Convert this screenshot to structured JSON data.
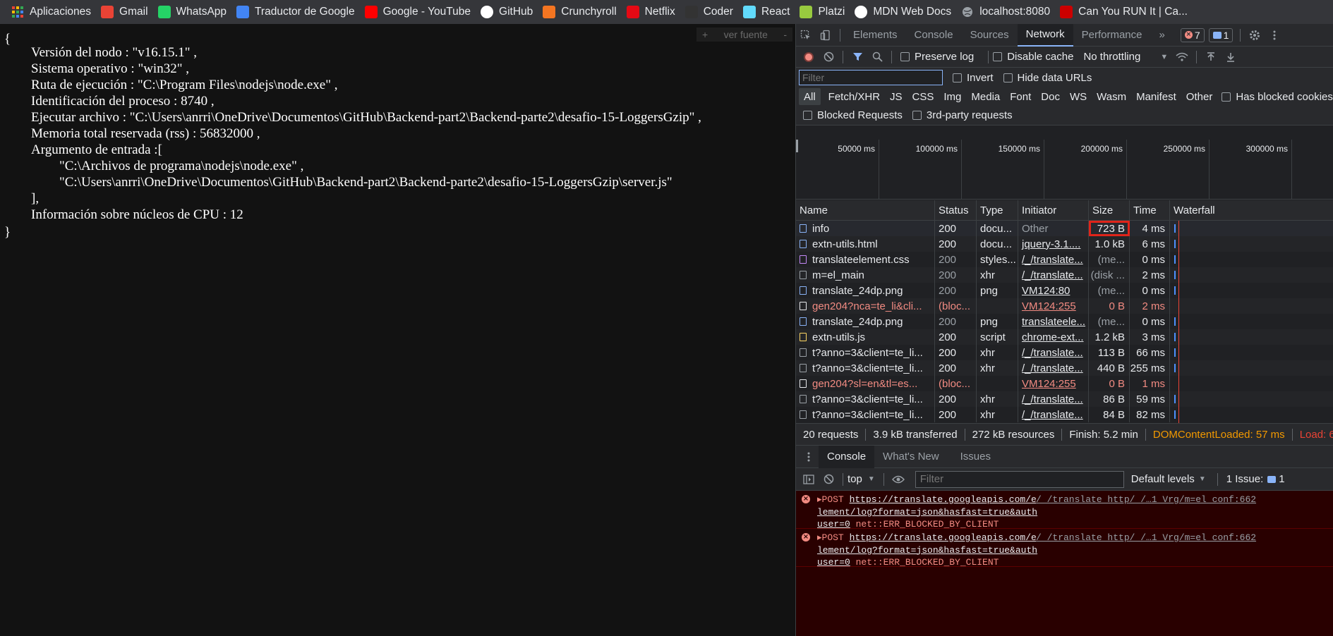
{
  "bookmarks": [
    {
      "label": "Aplicaciones",
      "icon": "apps-grid-icon",
      "color": "#4285f4"
    },
    {
      "label": "Gmail",
      "icon": "gmail-icon",
      "color": "#ea4335"
    },
    {
      "label": "WhatsApp",
      "icon": "whatsapp-icon",
      "color": "#25d366"
    },
    {
      "label": "Traductor de Google",
      "icon": "google-translate-icon",
      "color": "#4285f4"
    },
    {
      "label": "Google - YouTube",
      "icon": "youtube-icon",
      "color": "#ff0000"
    },
    {
      "label": "GitHub",
      "icon": "github-icon",
      "color": "#ffffff"
    },
    {
      "label": "Crunchyroll",
      "icon": "crunchyroll-icon",
      "color": "#f47521"
    },
    {
      "label": "Netflix",
      "icon": "netflix-icon",
      "color": "#e50914"
    },
    {
      "label": "Coder",
      "icon": "coder-icon",
      "color": "#333333"
    },
    {
      "label": "React",
      "icon": "react-icon",
      "color": "#61dafb"
    },
    {
      "label": "Platzi",
      "icon": "platzi-icon",
      "color": "#98ca3f"
    },
    {
      "label": "MDN Web Docs",
      "icon": "mdn-icon",
      "color": "#ffffff"
    },
    {
      "label": "localhost:8080",
      "icon": "globe-icon",
      "color": "#9aa0a6"
    },
    {
      "label": "Can You RUN It | Ca...",
      "icon": "canyourunit-icon",
      "color": "#cc0000"
    }
  ],
  "page": {
    "open_brace": "{",
    "close_brace": "}",
    "view_source": "ver fuente",
    "view_source_plus": "+",
    "view_source_minus": "-",
    "lines": [
      "Versión del nodo : \"v16.15.1\" ,",
      "Sistema operativo : \"win32\" ,",
      "Ruta de ejecución : \"C:\\Program Files\\nodejs\\node.exe\" ,",
      "Identificación del proceso : 8740 ,",
      "Ejecutar archivo : \"C:\\Users\\anrri\\OneDrive\\Documentos\\GitHub\\Backend-part2\\Backend-parte2\\desafio-15-LoggersGzip\" ,",
      "Memoria total reservada (rss) : 56832000 ,",
      "Argumento de entrada :[",
      "\"C:\\Archivos de programa\\nodejs\\node.exe\" ,",
      "\"C:\\Users\\anrri\\OneDrive\\Documentos\\GitHub\\Backend-part2\\Backend-parte2\\desafio-15-LoggersGzip\\server.js\"",
      "],",
      "Información sobre núcleos de CPU : 12"
    ]
  },
  "devtools": {
    "tabs": [
      "Elements",
      "Console",
      "Sources",
      "Network",
      "Performance"
    ],
    "active_tab": "Network",
    "more": "»",
    "errors_count": "7",
    "issues_count": "1",
    "network_toolbar": {
      "preserve_log": "Preserve log",
      "disable_cache": "Disable cache",
      "throttling": "No throttling"
    },
    "filter_bar": {
      "placeholder": "Filter",
      "invert": "Invert",
      "hide_data_urls": "Hide data URLs"
    },
    "types": [
      "All",
      "Fetch/XHR",
      "JS",
      "CSS",
      "Img",
      "Media",
      "Font",
      "Doc",
      "WS",
      "Wasm",
      "Manifest",
      "Other"
    ],
    "has_blocked_cookies": "Has blocked cookies",
    "blocked_requests": "Blocked Requests",
    "third_party": "3rd-party requests",
    "timeline_ticks": [
      "50000 ms",
      "100000 ms",
      "150000 ms",
      "200000 ms",
      "250000 ms",
      "300000 ms"
    ],
    "columns": [
      "Name",
      "Status",
      "Type",
      "Initiator",
      "Size",
      "Time",
      "Waterfall"
    ],
    "requests": [
      {
        "name": "info",
        "status": "200",
        "type": "docu...",
        "initiator": "Other",
        "size": "723 B",
        "time": "4 ms",
        "kind": "doc",
        "error": false,
        "dim": false
      },
      {
        "name": "extn-utils.html",
        "status": "200",
        "type": "docu...",
        "initiator": "jquery-3.1....",
        "size": "1.0 kB",
        "time": "6 ms",
        "kind": "doc",
        "error": false,
        "dim": false
      },
      {
        "name": "translateelement.css",
        "status": "200",
        "type": "styles...",
        "initiator": "/_/translate...",
        "size": "(me...",
        "time": "0 ms",
        "kind": "css",
        "error": false,
        "dim": true
      },
      {
        "name": "m=el_main",
        "status": "200",
        "type": "xhr",
        "initiator": "/_/translate...",
        "size": "(disk ...",
        "time": "2 ms",
        "kind": "xhr",
        "error": false,
        "dim": true
      },
      {
        "name": "translate_24dp.png",
        "status": "200",
        "type": "png",
        "initiator": "VM124:80",
        "size": "(me...",
        "time": "0 ms",
        "kind": "img",
        "error": false,
        "dim": true
      },
      {
        "name": "gen204?nca=te_li&cli...",
        "status": "(bloc...",
        "type": "",
        "initiator": "VM124:255",
        "size": "0 B",
        "time": "2 ms",
        "kind": "other",
        "error": true,
        "dim": false
      },
      {
        "name": "translate_24dp.png",
        "status": "200",
        "type": "png",
        "initiator": "translateele...",
        "size": "(me...",
        "time": "0 ms",
        "kind": "img",
        "error": false,
        "dim": true
      },
      {
        "name": "extn-utils.js",
        "status": "200",
        "type": "script",
        "initiator": "chrome-ext...",
        "size": "1.2 kB",
        "time": "3 ms",
        "kind": "js",
        "error": false,
        "dim": false
      },
      {
        "name": "t?anno=3&client=te_li...",
        "status": "200",
        "type": "xhr",
        "initiator": "/_/translate...",
        "size": "113 B",
        "time": "66 ms",
        "kind": "xhr",
        "error": false,
        "dim": false
      },
      {
        "name": "t?anno=3&client=te_li...",
        "status": "200",
        "type": "xhr",
        "initiator": "/_/translate...",
        "size": "440 B",
        "time": "255 ms",
        "kind": "xhr",
        "error": false,
        "dim": false
      },
      {
        "name": "gen204?sl=en&tl=es...",
        "status": "(bloc...",
        "type": "",
        "initiator": "VM124:255",
        "size": "0 B",
        "time": "1 ms",
        "kind": "other",
        "error": true,
        "dim": false
      },
      {
        "name": "t?anno=3&client=te_li...",
        "status": "200",
        "type": "xhr",
        "initiator": "/_/translate...",
        "size": "86 B",
        "time": "59 ms",
        "kind": "xhr",
        "error": false,
        "dim": false
      },
      {
        "name": "t?anno=3&client=te_li...",
        "status": "200",
        "type": "xhr",
        "initiator": "/_/translate...",
        "size": "84 B",
        "time": "82 ms",
        "kind": "xhr",
        "error": false,
        "dim": false
      }
    ],
    "summary": {
      "requests": "20 requests",
      "transferred": "3.9 kB transferred",
      "resources": "272 kB resources",
      "finish": "Finish: 5.2 min",
      "dcl": "DOMContentLoaded: 57 ms",
      "load": "Load: 6"
    },
    "drawer_tabs": [
      "Console",
      "What's New",
      "Issues"
    ],
    "console_bar": {
      "context": "top",
      "filter_placeholder": "Filter",
      "levels": "Default levels",
      "issues": "1 Issue:",
      "issues_count": "1"
    },
    "messages": [
      {
        "method": "POST",
        "url_a": "https://translate.googleapis.com/e",
        "url_b": "lement/log?format=json&hasfast=true&auth",
        "url_c": "user=0",
        "error": "net::ERR_BLOCKED_BY_CLIENT",
        "source": "/_/translate_http/_/…1_Vrg/m=el_conf:662"
      },
      {
        "method": "POST",
        "url_a": "https://translate.googleapis.com/e",
        "url_b": "lement/log?format=json&hasfast=true&auth",
        "url_c": "user=0",
        "error": "net::ERR_BLOCKED_BY_CLIENT",
        "source": "/_/translate_http/_/…1_Vrg/m=el_conf:662"
      }
    ],
    "colors": {
      "accent": "#8ab4f8",
      "error_text": "#f28b82",
      "dcl": "#f29900",
      "load": "#ea4335"
    }
  }
}
